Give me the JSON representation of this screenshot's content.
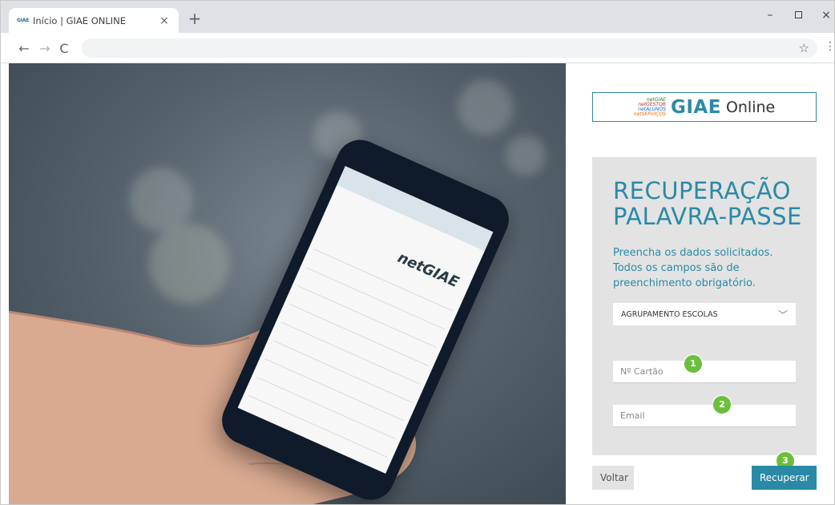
{
  "browser": {
    "tab_favicon": "GIAE",
    "tab_title": "Início | GIAE ONLINE",
    "tab_close": "×",
    "new_tab": "+",
    "minimize": "–",
    "close": "×"
  },
  "toolbar": {
    "back": "←",
    "forward": "→",
    "reload": "C",
    "star": "☆",
    "menu": "⋮"
  },
  "logo": {
    "sub_lines": [
      "netGIAE",
      "netGESTOR",
      "netALUNOS",
      "netSERVIÇOS"
    ],
    "main": "GIAE",
    "online": "Online"
  },
  "phone": {
    "logo": "netGIAE"
  },
  "form": {
    "title_line1": "RECUPERAÇÃO",
    "title_line2": "PALAVRA-PASSE",
    "description": "Preencha os dados solicitados. Todos os campos são de preenchimento obrigatório.",
    "select_value": "AGRUPAMENTO ESCOLAS",
    "card_placeholder": "Nº Cartão",
    "email_placeholder": "Email"
  },
  "steps": [
    "1",
    "2",
    "3"
  ],
  "buttons": {
    "back": "Voltar",
    "recover": "Recuperar"
  },
  "colors": {
    "accent": "#2a8aa6",
    "panel": "#e3e3e3",
    "badge": "#6bbf3a"
  }
}
